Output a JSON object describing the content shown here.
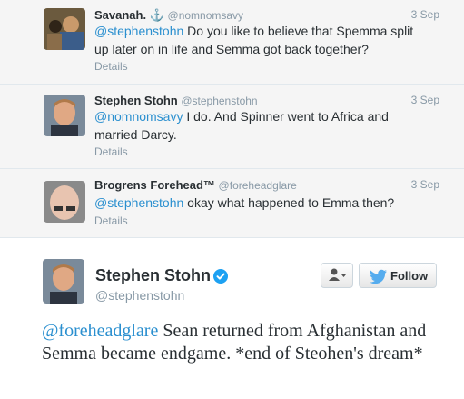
{
  "replies": [
    {
      "name": "Savanah. ⚓",
      "handle": "@nomnomsavy",
      "time": "3 Sep",
      "mention": "@stephenstohn",
      "text": " Do you like to believe that Spemma split up later on in life and Semma got back together?",
      "details": "Details"
    },
    {
      "name": "Stephen Stohn",
      "handle": "@stephenstohn",
      "time": "3 Sep",
      "mention": "@nomnomsavy",
      "text": " I do. And Spinner went to Africa and married Darcy.",
      "details": "Details"
    },
    {
      "name": "Brogrens Forehead™",
      "handle": "@foreheadglare",
      "time": "3 Sep",
      "mention": "@stephenstohn",
      "text": " okay what happened to Emma then?",
      "details": "Details"
    }
  ],
  "main_tweet": {
    "name": "Stephen Stohn",
    "handle": "@stephenstohn",
    "mention": "@foreheadglare",
    "text": " Sean returned from Afghanistan and Semma became endgame. *end of Steohen's dream*",
    "follow_label": "Follow"
  },
  "colors": {
    "link": "#2a8fcf",
    "verified": "#1da1f2",
    "reply_bg": "#f5f5f5"
  }
}
